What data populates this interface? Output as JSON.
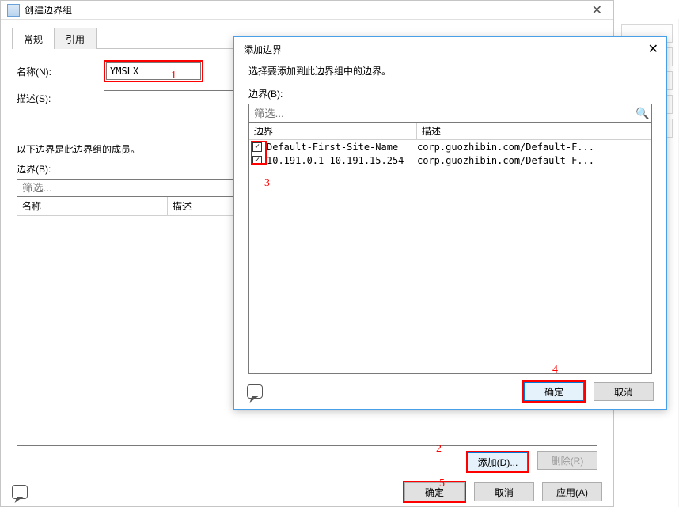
{
  "main_window": {
    "title": "创建边界组",
    "tabs": {
      "general": "常规",
      "refs": "引用"
    },
    "labels": {
      "name": "名称(N):",
      "desc": "描述(S):",
      "members_note": "以下边界是此边界组的成员。",
      "boundary": "边界(B):",
      "filter_placeholder": "筛选...",
      "col_name": "名称",
      "col_desc": "描述"
    },
    "name_value": "YMSLX",
    "buttons": {
      "add": "添加(D)...",
      "remove": "删除(R)",
      "ok": "确定",
      "cancel": "取消",
      "apply": "应用(A)"
    }
  },
  "add_dialog": {
    "title": "添加边界",
    "instruction": "选择要添加到此边界组中的边界。",
    "boundary_label": "边界(B):",
    "filter_placeholder": "筛选...",
    "cols": {
      "boundary": "边界",
      "desc": "描述"
    },
    "rows": [
      {
        "checked": true,
        "name": "Default-First-Site-Name",
        "desc": "corp.guozhibin.com/Default-F..."
      },
      {
        "checked": true,
        "name": "10.191.0.1-10.191.15.254",
        "desc": "corp.guozhibin.com/Default-F..."
      }
    ],
    "buttons": {
      "ok": "确定",
      "cancel": "取消"
    }
  },
  "annotations": {
    "n1": "1",
    "n2": "2",
    "n3": "3",
    "n4": "4",
    "n5": "5"
  }
}
